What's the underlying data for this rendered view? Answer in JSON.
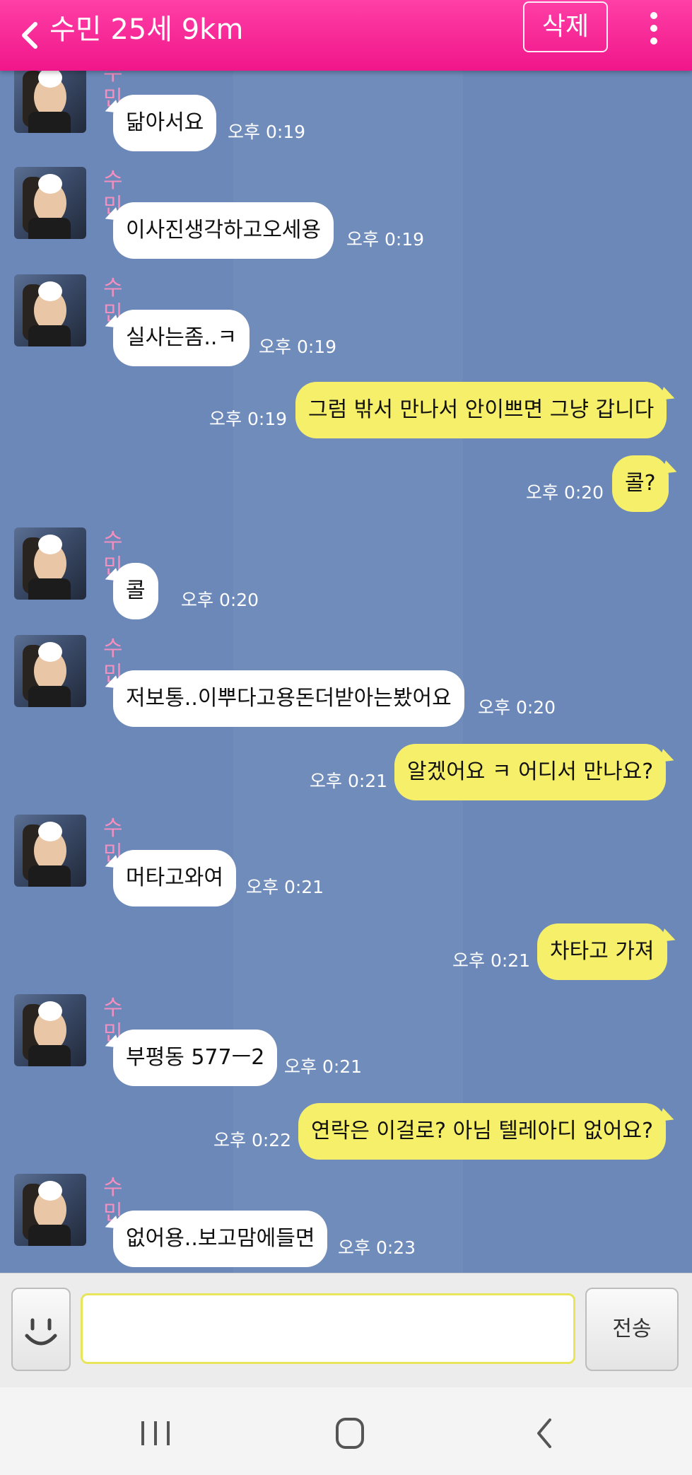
{
  "header": {
    "title": "수민 25세 9km",
    "delete_label": "삭제",
    "back_icon": "chevron-left-icon",
    "more_icon": "more-vertical-icon"
  },
  "colors": {
    "header": "#f0168a",
    "chat_background": "#6b88b8",
    "incoming_bubble": "#ffffff",
    "outgoing_bubble": "#f6ef6a",
    "sender_name": "#f48fc0"
  },
  "messages": [
    {
      "dir": "in",
      "sender": "수민",
      "text": "닮아서요",
      "time": "오후 0:19"
    },
    {
      "dir": "in",
      "sender": "수민",
      "text": "이사진생각하고오세용",
      "time": "오후 0:19"
    },
    {
      "dir": "in",
      "sender": "수민",
      "text": "실사는좀..ㅋ",
      "time": "오후 0:19"
    },
    {
      "dir": "out",
      "text": "그럼 밖서 만나서 안이쁘면 그냥 갑니다",
      "time": "오후 0:19"
    },
    {
      "dir": "out",
      "text": "콜?",
      "time": "오후 0:20"
    },
    {
      "dir": "in",
      "sender": "수민",
      "text": "콜",
      "time": "오후 0:20"
    },
    {
      "dir": "in",
      "sender": "수민",
      "text": "저보통..이뿌다고용돈더받아는봤어요",
      "time": "오후 0:20"
    },
    {
      "dir": "out",
      "text": "알겠어요 ㅋ 어디서 만나요?",
      "time": "오후 0:21"
    },
    {
      "dir": "in",
      "sender": "수민",
      "text": "머타고와여",
      "time": "오후 0:21"
    },
    {
      "dir": "out",
      "text": "차타고 가져",
      "time": "오후 0:21"
    },
    {
      "dir": "in",
      "sender": "수민",
      "text": "부평동 577ㅡ2",
      "time": "오후 0:21"
    },
    {
      "dir": "out",
      "text": "연락은 이걸로? 아님 텔레아디 없어요?",
      "time": "오후 0:22"
    },
    {
      "dir": "in",
      "sender": "수민",
      "text": "없어용..보고맘에들면",
      "time": "오후 0:23"
    }
  ],
  "input": {
    "value": "",
    "placeholder": "",
    "send_label": "전송",
    "emoji_icon": "smiley-icon"
  },
  "navbar": {
    "recents_icon": "recent-apps-icon",
    "home_icon": "home-icon",
    "back_icon": "back-icon"
  }
}
